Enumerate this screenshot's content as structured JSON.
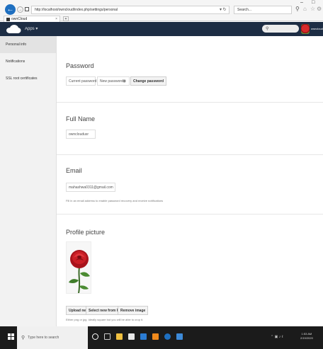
{
  "browser": {
    "url": "http://localhost/owncloud/index.php/settings/personal",
    "search_placeholder": "Search...",
    "tab_title": "ownCloud",
    "new_tab": "+"
  },
  "header": {
    "apps_label": "Apps ▾",
    "username": "owncloudusr"
  },
  "sidebar": {
    "items": [
      {
        "label": "Personal info"
      },
      {
        "label": "Notifications"
      },
      {
        "label": "SSL root certificates"
      }
    ]
  },
  "password": {
    "title": "Password",
    "current_placeholder": "Current password",
    "new_placeholder": "New password",
    "change_button": "Change password"
  },
  "full_name": {
    "title": "Full Name",
    "value": "owncloudusr"
  },
  "email": {
    "title": "Email",
    "value": "mahashwa0311@gmail.com",
    "hint": "Fill in an email address to enable password recovery and receive notifications"
  },
  "profile": {
    "title": "Profile picture",
    "upload_button": "Upload new",
    "select_button": "Select new from Files",
    "remove_button": "Remove image",
    "hint": "Either png or jpg. Ideally square but you will be able to crop it."
  },
  "taskbar": {
    "search_placeholder": "Type here to search",
    "clock_time": "1:53 AM",
    "clock_date": "2/19/2020"
  },
  "colors": {
    "header_bg": "#1d2d44",
    "accent": "#1e6fc0"
  }
}
